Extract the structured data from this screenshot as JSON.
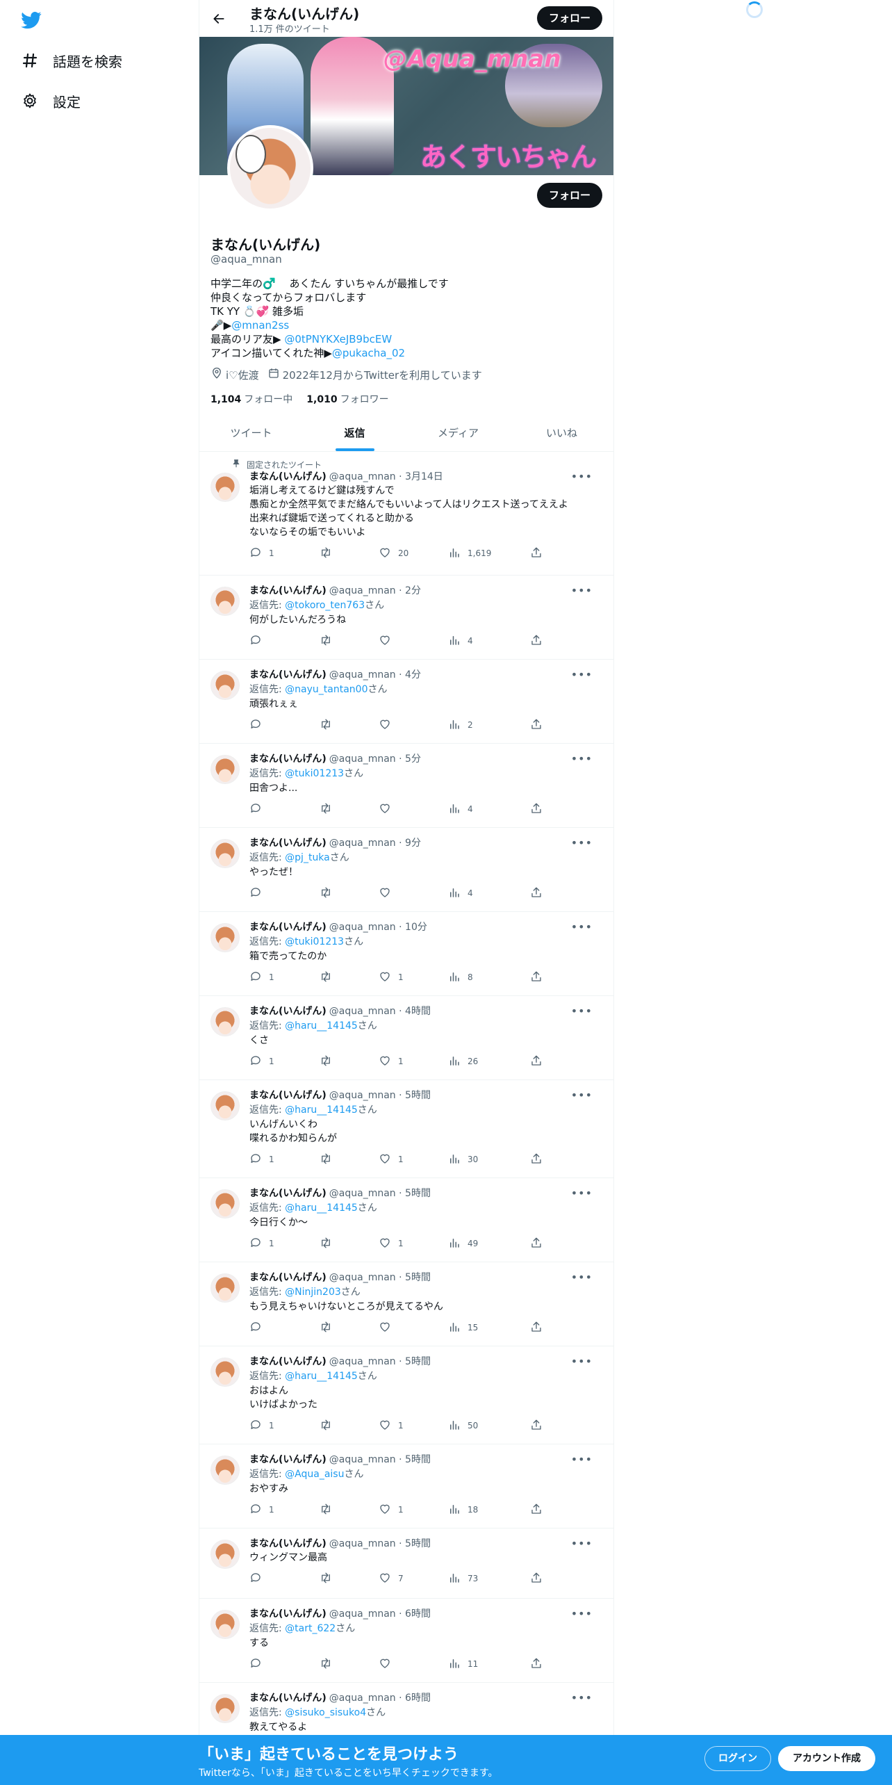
{
  "nav": {
    "logo_icon": "twitter-bird-icon",
    "explore_label": "話題を検索",
    "settings_label": "設定"
  },
  "header": {
    "title": "まなん(いんげん)",
    "subtitle": "1.1万 件のツイート",
    "follow_label": "フォロー"
  },
  "banner": {
    "handle_text": "@Aqua_mnan",
    "logo_text": "あくすいちゃんねる"
  },
  "profile": {
    "name": "まなん(いんげん)",
    "handle": "@aqua_mnan",
    "follow_label": "フォロー",
    "bio": {
      "line1": "中学二年の♂️　 あくたん  すいちゃんが最推しです",
      "line2": "仲良くなってからフォロバします",
      "line3": "TK   YY   💍💞 雑多垢",
      "line4_prefix": "🎤▶",
      "line4_link": "@mnan2ss",
      "line5_prefix": "最高のリア友▶ ",
      "line5_link": "@0tPNYKXeJB9bcEW",
      "line6_prefix": "アイコン描いてくれた神▶",
      "line6_link": "@pukacha_02"
    },
    "location": "i♡佐渡",
    "joined": "2022年12月からTwitterを利用しています",
    "following_count": "1,104",
    "following_label": "フォロー中",
    "followers_count": "1,010",
    "followers_label": "フォロワー"
  },
  "tabs": {
    "tweets": "ツイート",
    "replies": "返信",
    "media": "メディア",
    "likes": "いいね"
  },
  "pinned_label": "固定されたツイート",
  "reply_prefix": "返信先: ",
  "reply_suffix": "さん",
  "tweets": [
    {
      "name": "まなん(いんげん)",
      "handle": "@aqua_mnan",
      "time": "3月14日",
      "reply_to": "",
      "lines": [
        "垢消し考えてるけど鍵は残すんで",
        "愚痴とか全然平気でまだ絡んでもいいよって人はリクエスト送ってええよ",
        "出来れば鍵垢で送ってくれると助かる",
        "ないならその垢でもいいよ"
      ],
      "replies": "1",
      "retweets": "",
      "likes": "20",
      "views": "1,619"
    },
    {
      "name": "まなん(いんげん)",
      "handle": "@aqua_mnan",
      "time": "2分",
      "reply_to": "@tokoro_ten763",
      "lines": [
        "何がしたいんだろうね"
      ],
      "replies": "",
      "retweets": "",
      "likes": "",
      "views": "4"
    },
    {
      "name": "まなん(いんげん)",
      "handle": "@aqua_mnan",
      "time": "4分",
      "reply_to": "@nayu_tantan00",
      "lines": [
        "頑張れぇぇ"
      ],
      "replies": "",
      "retweets": "",
      "likes": "",
      "views": "2"
    },
    {
      "name": "まなん(いんげん)",
      "handle": "@aqua_mnan",
      "time": "5分",
      "reply_to": "@tuki01213",
      "lines": [
        "田舎つよ..."
      ],
      "replies": "",
      "retweets": "",
      "likes": "",
      "views": "4"
    },
    {
      "name": "まなん(いんげん)",
      "handle": "@aqua_mnan",
      "time": "9分",
      "reply_to": "@pj_tuka",
      "lines": [
        "やったぜ！"
      ],
      "replies": "",
      "retweets": "",
      "likes": "",
      "views": "4"
    },
    {
      "name": "まなん(いんげん)",
      "handle": "@aqua_mnan",
      "time": "10分",
      "reply_to": "@tuki01213",
      "lines": [
        "箱で売ってたのか"
      ],
      "replies": "1",
      "retweets": "",
      "likes": "1",
      "views": "8"
    },
    {
      "name": "まなん(いんげん)",
      "handle": "@aqua_mnan",
      "time": "4時間",
      "reply_to": "@haru__14145",
      "lines": [
        "くさ"
      ],
      "replies": "1",
      "retweets": "",
      "likes": "1",
      "views": "26"
    },
    {
      "name": "まなん(いんげん)",
      "handle": "@aqua_mnan",
      "time": "5時間",
      "reply_to": "@haru__14145",
      "lines": [
        "いんげんいくわ",
        "喋れるかわ知らんが"
      ],
      "replies": "1",
      "retweets": "",
      "likes": "1",
      "views": "30"
    },
    {
      "name": "まなん(いんげん)",
      "handle": "@aqua_mnan",
      "time": "5時間",
      "reply_to": "@haru__14145",
      "lines": [
        "今日行くか〜"
      ],
      "replies": "1",
      "retweets": "",
      "likes": "1",
      "views": "49"
    },
    {
      "name": "まなん(いんげん)",
      "handle": "@aqua_mnan",
      "time": "5時間",
      "reply_to": "@Ninjin203",
      "lines": [
        "もう見えちゃいけないところが見えてるやん"
      ],
      "replies": "",
      "retweets": "",
      "likes": "",
      "views": "15"
    },
    {
      "name": "まなん(いんげん)",
      "handle": "@aqua_mnan",
      "time": "5時間",
      "reply_to": "@haru__14145",
      "lines": [
        "おはよん",
        "いけばよかった"
      ],
      "replies": "1",
      "retweets": "",
      "likes": "1",
      "views": "50"
    },
    {
      "name": "まなん(いんげん)",
      "handle": "@aqua_mnan",
      "time": "5時間",
      "reply_to": "@Aqua_aisu",
      "lines": [
        "おやすみ"
      ],
      "replies": "1",
      "retweets": "",
      "likes": "1",
      "views": "18"
    },
    {
      "name": "まなん(いんげん)",
      "handle": "@aqua_mnan",
      "time": "5時間",
      "reply_to": "",
      "lines": [
        "ウィングマン最高"
      ],
      "replies": "",
      "retweets": "",
      "likes": "7",
      "views": "73"
    },
    {
      "name": "まなん(いんげん)",
      "handle": "@aqua_mnan",
      "time": "6時間",
      "reply_to": "@tart_622",
      "lines": [
        "する"
      ],
      "replies": "",
      "retweets": "",
      "likes": "",
      "views": "11"
    },
    {
      "name": "まなん(いんげん)",
      "handle": "@aqua_mnan",
      "time": "6時間",
      "reply_to": "@sisuko_sisuko4",
      "lines": [
        "教えてやるよ"
      ],
      "replies": "",
      "retweets": "",
      "likes": "",
      "views": ""
    }
  ],
  "bottom_bar": {
    "title": "「いま」起きていることを見つけよう",
    "subtitle": "Twitterなら、「いま」起きていることをいち早くチェックできます。",
    "login_label": "ログイン",
    "signup_label": "アカウント作成"
  },
  "colors": {
    "accent": "#1d9bf0",
    "text": "#0f1419",
    "muted": "#536471",
    "border": "#eff3f4"
  }
}
